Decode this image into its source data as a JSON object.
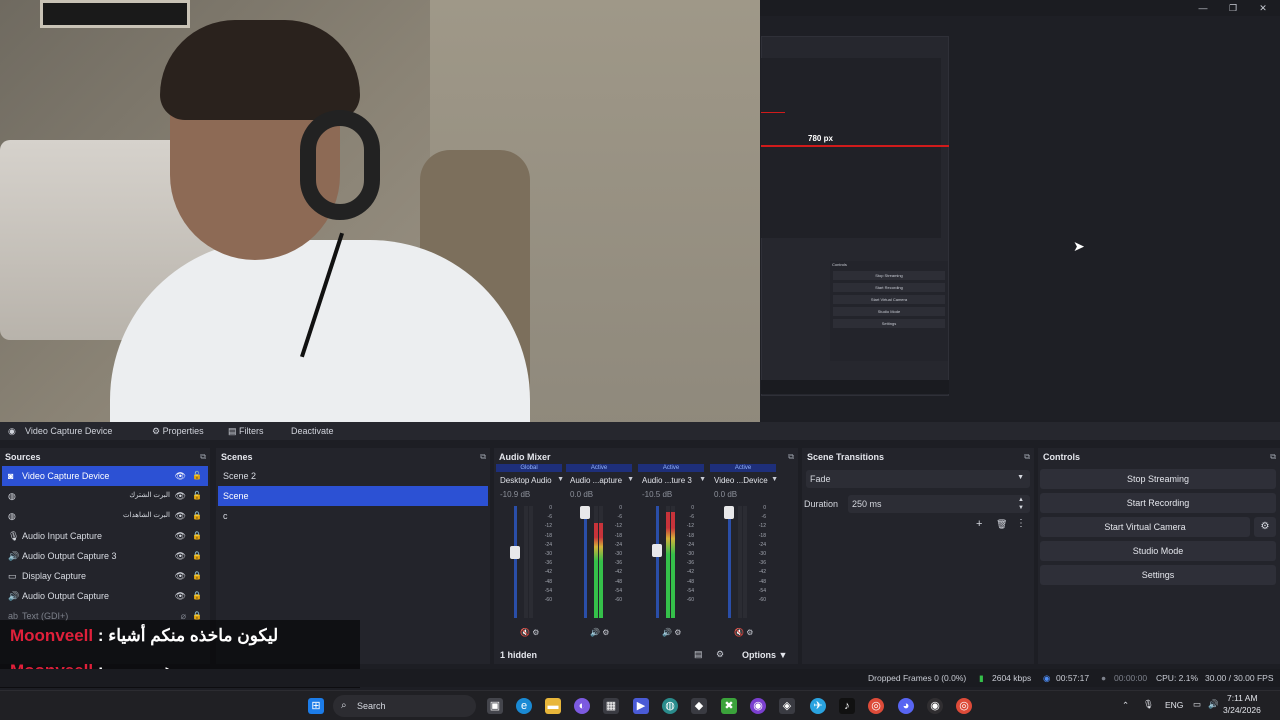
{
  "source_toolbar": {
    "selected_source": "Video Capture Device",
    "properties": "Properties",
    "filters": "Filters",
    "deactivate": "Deactivate"
  },
  "preview": {
    "measure_label": "780 px",
    "mini_controls": [
      "Stop Streaming",
      "Start Recording",
      "Start Virtual Camera",
      "Studio Mode",
      "Settings"
    ],
    "mini_controls_title": "Controls"
  },
  "sources": {
    "title": "Sources",
    "items": [
      {
        "label": "Video Capture Device",
        "icon": "camera-icon",
        "selected": true
      },
      {
        "label": "البرت الشترك",
        "icon": "globe-icon",
        "selected": false,
        "rtl": true
      },
      {
        "label": "البرت الشاهدات",
        "icon": "globe-icon",
        "selected": false,
        "rtl": true
      },
      {
        "label": "Audio Input Capture",
        "icon": "microphone-icon",
        "selected": false
      },
      {
        "label": "Audio Output Capture 3",
        "icon": "speaker-icon",
        "selected": false
      },
      {
        "label": "Display Capture",
        "icon": "monitor-icon",
        "selected": false
      },
      {
        "label": "Audio Output Capture",
        "icon": "speaker-icon",
        "selected": false
      },
      {
        "label": "Text (GDI+)",
        "icon": "text-icon",
        "selected": false
      }
    ]
  },
  "scenes": {
    "title": "Scenes",
    "items": [
      {
        "label": "Scene 2",
        "selected": false
      },
      {
        "label": "Scene",
        "selected": true
      },
      {
        "label": "c",
        "selected": false
      }
    ]
  },
  "mixer": {
    "title": "Audio Mixer",
    "channels": [
      {
        "status": "Global",
        "name": "Desktop Audio",
        "db": "-10.9 dB",
        "fader": 0.6,
        "meter": 0.0
      },
      {
        "status": "Active",
        "name": "Audio ...apture",
        "db": "0.0 dB",
        "fader": 1.0,
        "meter": 0.85
      },
      {
        "status": "Active",
        "name": "Audio ...ture 3",
        "db": "-10.5 dB",
        "fader": 0.62,
        "meter": 0.95
      },
      {
        "status": "Active",
        "name": "Video ...Device",
        "db": "0.0 dB",
        "fader": 1.0,
        "meter": 0.0
      }
    ],
    "scale": [
      "0",
      "-6",
      "-12",
      "-18",
      "-24",
      "-30",
      "-36",
      "-42",
      "-48",
      "-54",
      "-60"
    ],
    "hidden": "1 hidden",
    "options": "Options"
  },
  "transitions": {
    "title": "Scene Transitions",
    "selected": "Fade",
    "duration_label": "Duration",
    "duration_value": "250 ms"
  },
  "controls": {
    "title": "Controls",
    "buttons": [
      "Stop Streaming",
      "Start Recording",
      "Start Virtual Camera",
      "Studio Mode",
      "Settings"
    ]
  },
  "chat": [
    {
      "user": "Moonveell",
      "message": "ليكون ماخذه منكم أشياء"
    },
    {
      "user": "Moonveell",
      "message": "هههههههه"
    }
  ],
  "status": {
    "dropped": "Dropped Frames 0 (0.0%)",
    "bitrate": "2604 kbps",
    "stream_time": "00:57:17",
    "rec_time": "00:00:00",
    "cpu": "CPU: 2.1%",
    "fps": "30.00 / 30.00 FPS"
  },
  "taskbar": {
    "search": "Search",
    "lang": "ENG",
    "time": "7:11 AM",
    "date": "3/24/2026"
  },
  "colors": {
    "accent": "#2c51d4",
    "dock_bg": "#23242b",
    "chat_user": "#e0203a",
    "meter_green": "#35c04a",
    "meter_red": "#c8333a"
  }
}
